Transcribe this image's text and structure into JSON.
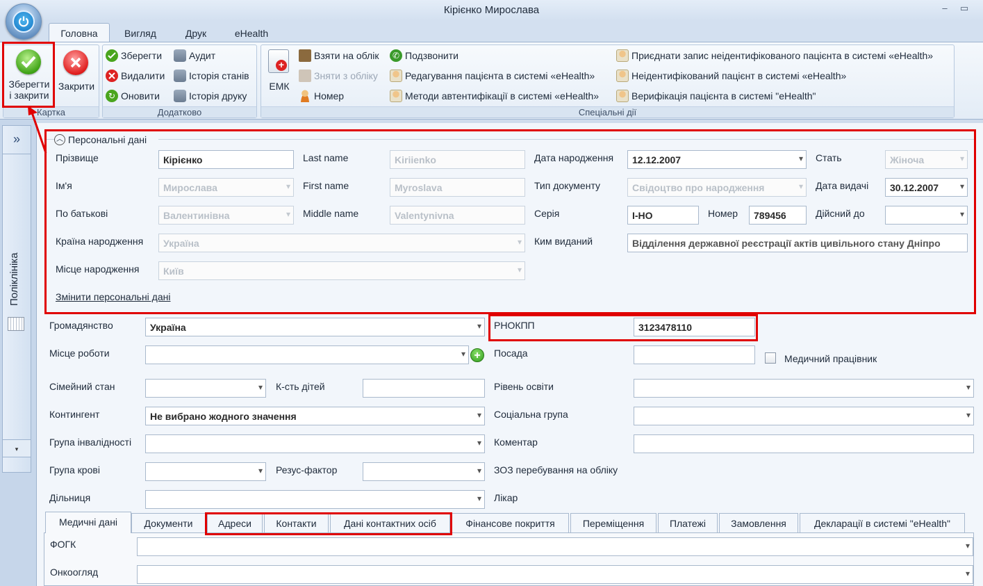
{
  "window": {
    "title": "Кірієнко Мирослава"
  },
  "ribbon_tabs": [
    "Головна",
    "Вигляд",
    "Друк",
    "eHealth"
  ],
  "groups": {
    "card": {
      "label": "Картка",
      "save_close": "Зберегти\nі закрити",
      "close": "Закрити"
    },
    "extra": {
      "label": "Додатково",
      "save": "Зберегти",
      "delete": "Видалити",
      "refresh": "Оновити",
      "audit": "Аудит",
      "state_history": "Історія станів",
      "print_history": "Історія друку"
    },
    "special": {
      "label": "Спеціальні дії",
      "emk": "ЕМК",
      "take_register": "Взяти на облік",
      "remove_register": "Зняти з обліку",
      "number": "Номер",
      "call": "Подзвонити",
      "edit_patient": "Редагування пацієнта в системі «eHealth»",
      "auth_methods": "Методи автентифікації в системі «eHealth»",
      "attach_record": "Приєднати запис неідентифікованого пацієнта в системі «eHealth»",
      "unidentified": "Неідентифікований пацієнт в системі «eHealth»",
      "verification": "Верифікація пацієнта в системі \"eHealth\""
    }
  },
  "side": {
    "label": "Поліклініка"
  },
  "personal": {
    "legend": "Персональні дані",
    "surname_label": "Прізвище",
    "surname": "Кірієнко",
    "name_label": "Ім'я",
    "name": "Мирослава",
    "patronymic_label": "По батькові",
    "patronymic": "Валентинівна",
    "country_label": "Країна народження",
    "country": "Україна",
    "place_label": "Місце народження",
    "place": "Київ",
    "lastname_label": "Last name",
    "lastname": "Kiriienko",
    "firstname_label": "First name",
    "firstname": "Myroslava",
    "middlename_label": "Middle name",
    "middlename": "Valentynivna",
    "dob_label": "Дата народження",
    "dob": "12.12.2007",
    "doctype_label": "Тип документу",
    "doctype": "Свідоцтво про народження",
    "series_label": "Серія",
    "series": "І-НО",
    "number_label": "Номер",
    "number": "789456",
    "issuer_label": "Ким виданий",
    "issuer": "Відділення державної реєстрації актів цивільного стану  Дніпро",
    "sex_label": "Стать",
    "sex": "Жіноча",
    "issue_date_label": "Дата видачі",
    "issue_date": "30.12.2007",
    "valid_until_label": "Дійсний до",
    "valid_until": "",
    "change_link": "Змінити персональні дані"
  },
  "form": {
    "citizenship_label": "Громадянство",
    "citizenship": "Україна",
    "rnokpp_label": "РНОКПП",
    "rnokpp": "3123478110",
    "workplace_label": "Місце роботи",
    "workplace": "",
    "position_label": "Посада",
    "position": "",
    "medworker_label": "Медичний працівник",
    "medworker": false,
    "marital_label": "Сімейний стан",
    "marital": "",
    "children_label": "К-сть дітей",
    "children": "",
    "education_label": "Рівень освіти",
    "education": "",
    "contingent_label": "Контингент",
    "contingent": "Не вибрано жодного значення",
    "social_label": "Соціальна група",
    "social": "",
    "disability_label": "Група інвалідності",
    "disability": "",
    "comment_label": "Коментар",
    "comment": "",
    "blood_label": "Група крові",
    "blood": "",
    "rh_label": "Резус-фактор",
    "rh": "",
    "zoz_label": "ЗОЗ перебування на обліку",
    "district_label": "Дільниця",
    "district": "",
    "doctor_label": "Лікар"
  },
  "bottom_tabs": [
    "Медичні дані",
    "Документи",
    "Адреси",
    "Контакти",
    "Дані контактних осіб",
    "Фінансове покриття",
    "Переміщення",
    "Платежі",
    "Замовлення",
    "Декларації в системі \"eHealth\""
  ],
  "medical": {
    "fogk_label": "ФОГК",
    "fogk": "",
    "onco_label": "Онкоогляд",
    "onco": ""
  },
  "colors": {
    "highlight": "#e00000",
    "ribbon_bg": "#e3ecf6",
    "accent": "#1275c4"
  }
}
